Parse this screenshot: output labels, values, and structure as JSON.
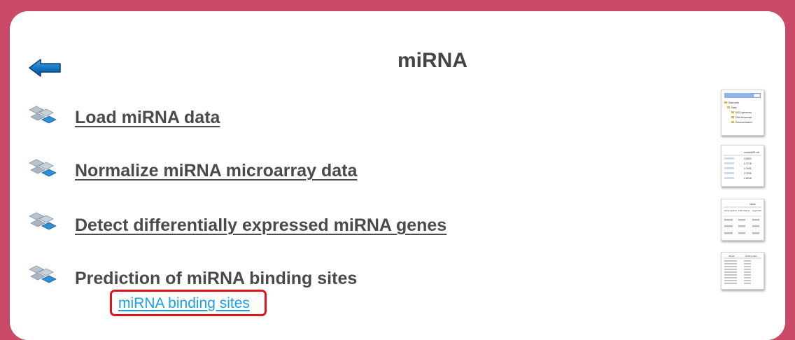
{
  "header": {
    "title": "miRNA",
    "back_icon": "back-arrow-icon"
  },
  "menu": {
    "items": [
      {
        "label": "Load miRNA data",
        "icon": "workflow-blocks-icon",
        "link": true
      },
      {
        "label": "Normalize miRNA microarray data",
        "icon": "workflow-blocks-icon",
        "link": true
      },
      {
        "label": "Detect differentially expressed miRNA genes",
        "icon": "workflow-blocks-icon",
        "link": true
      },
      {
        "label": "Prediction of miRNA binding sites",
        "icon": "workflow-blocks-icon",
        "link": false
      }
    ],
    "sublink": {
      "label": "miRNA binding sites"
    }
  },
  "thumbnails": [
    {
      "name": "thumb-load-data",
      "texts": [
        "Data sets",
        "Data",
        "NGS genomes",
        "DNA sequence",
        "Documentation"
      ]
    },
    {
      "name": "thumb-normalize",
      "texts": [
        "rosetaMIR.ctb",
        "0.8500",
        "2.7218",
        "4.3401",
        "4.7625",
        "3.8918"
      ]
    },
    {
      "name": "thumb-diff-expr",
      "texts": [
        "Value",
        "Gene symbol",
        "Fold change",
        "Log2 ratio"
      ]
    },
    {
      "name": "thumb-binding-sites",
      "texts": [
        "Target",
        "binding sites"
      ]
    }
  ],
  "colors": {
    "frame": "#c94a66",
    "panel": "#ffffff",
    "text": "#4a4a4a",
    "link": "#1aa0e8",
    "highlight_border": "#e0141b",
    "arrow_blue": "#0e6db3"
  }
}
